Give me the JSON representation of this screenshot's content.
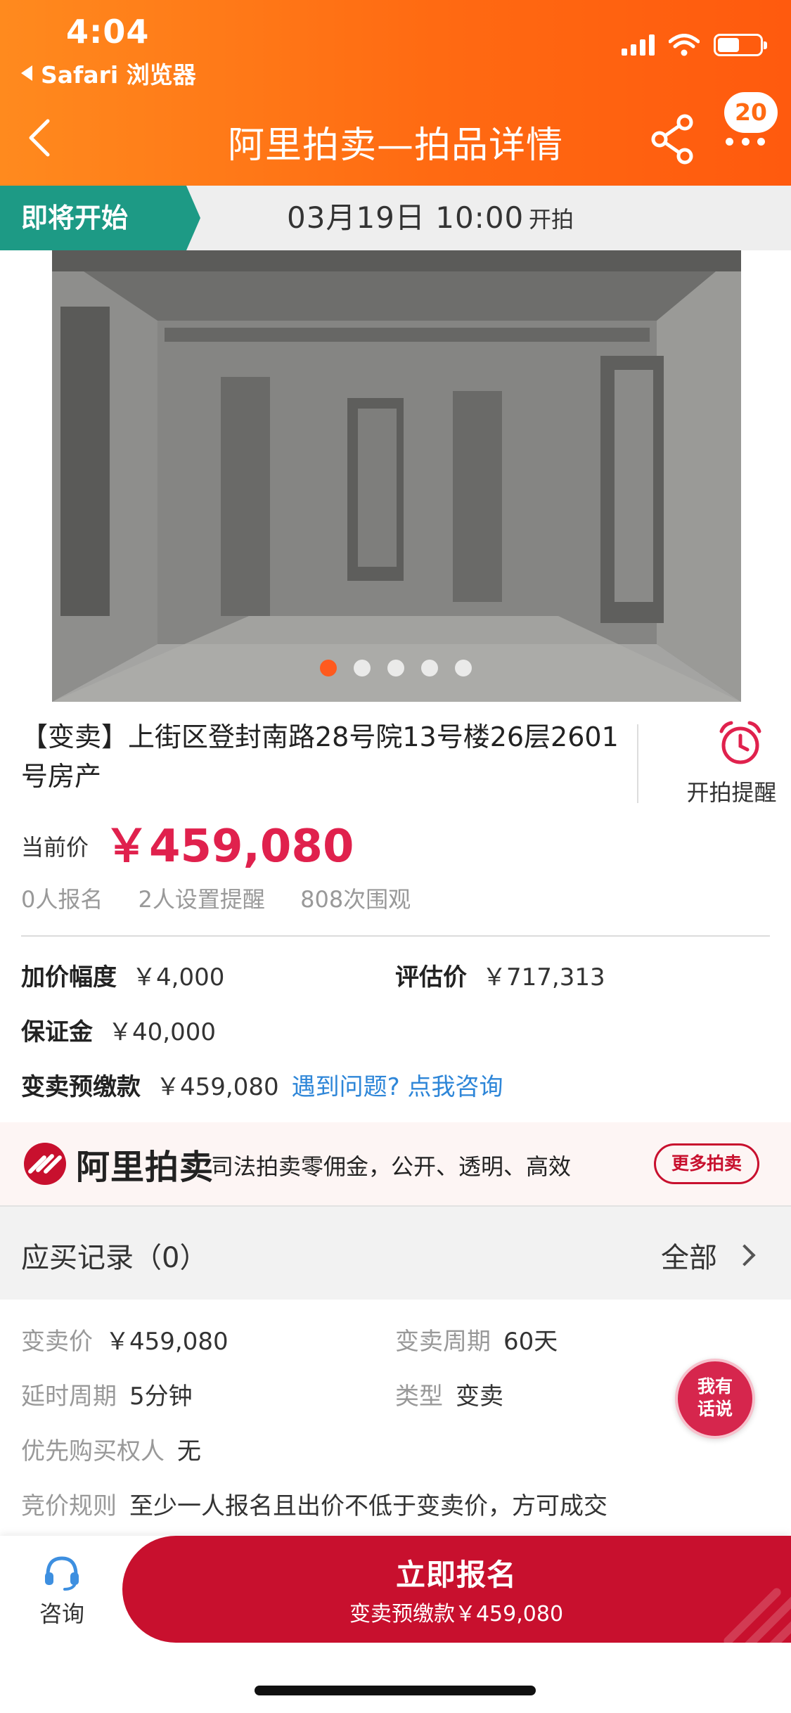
{
  "status_bar": {
    "time": "4:04",
    "back_app": "Safari 浏览器"
  },
  "header": {
    "title": "阿里拍卖—拍品详情",
    "badge_count": "20",
    "background_color": "#ff6a12"
  },
  "auction_strip": {
    "tag": "即将开始",
    "time": "03月19日 10:00",
    "suffix": "开拍",
    "tag_color": "#1d9a85"
  },
  "gallery": {
    "total_images": 5,
    "active_index": 0
  },
  "lot": {
    "title": "【变卖】上街区登封南路28号院13号楼26层2601号房产",
    "remind_label": "开拍提醒",
    "price_label": "当前价",
    "price_value": "￥459,080",
    "price_color": "#e0214d",
    "stats": [
      "0人报名",
      "2人设置提醒",
      "808次围观"
    ]
  },
  "details": {
    "increment_label": "加价幅度",
    "increment_value": "￥4,000",
    "appraisal_label": "评估价",
    "appraisal_value": "￥717,313",
    "deposit_label": "保证金",
    "deposit_value": "￥40,000",
    "prepay_label": "变卖预缴款",
    "prepay_value": "￥459,080",
    "help_link": "遇到问题? 点我咨询"
  },
  "banner": {
    "brand": "阿里拍卖",
    "slogan": "司法拍卖零佣金，公开、透明、高效",
    "more_button": "更多拍卖"
  },
  "records": {
    "title": "应买记录（0）",
    "all_label": "全部"
  },
  "info": {
    "sale_price_label": "变卖价",
    "sale_price_value": "￥459,080",
    "sale_period_label": "变卖周期",
    "sale_period_value": "60天",
    "delay_label": "延时周期",
    "delay_value": "5分钟",
    "type_label": "类型",
    "type_value": "变卖",
    "priority_label": "优先购买权人",
    "priority_value": "无",
    "rule_label": "竞价规则",
    "rule_value": "至少一人报名且出价不低于变卖价，方可成交"
  },
  "chat_fab": {
    "line1": "我有",
    "line2": "话说"
  },
  "bottom_bar": {
    "consult_label": "咨询",
    "signup_title": "立即报名",
    "signup_sub": "变卖预缴款￥459,080",
    "signup_color": "#c8102e"
  }
}
